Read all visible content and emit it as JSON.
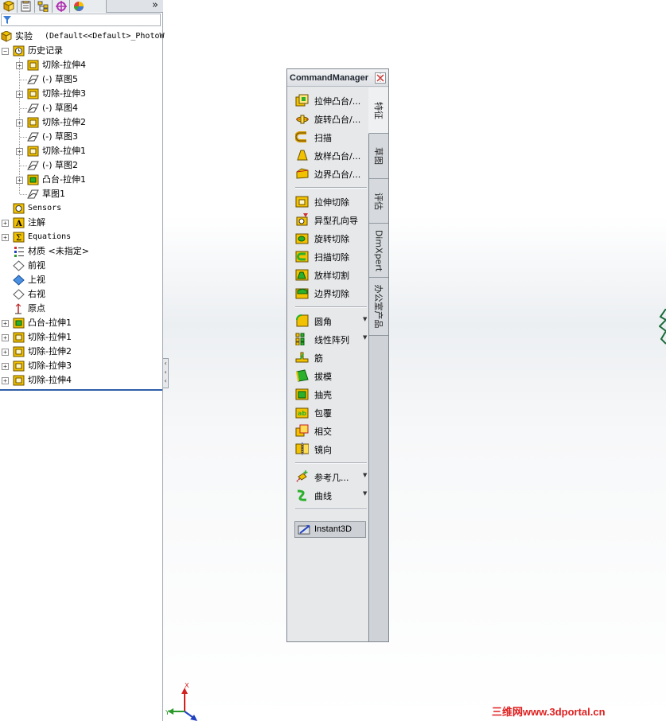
{
  "feature_manager": {
    "tabs": [
      "feature-tree-icon",
      "property-icon",
      "configuration-icon",
      "dimxpert-icon",
      "display-icon"
    ],
    "more": "»",
    "part_label": "实验",
    "part_config": "(Default<<Default>_PhotoW",
    "history": "历史记录",
    "history_items": [
      {
        "label": "切除-拉伸4",
        "type": "cut"
      },
      {
        "label": "(-) 草图5",
        "type": "sketch"
      },
      {
        "label": "切除-拉伸3",
        "type": "cut"
      },
      {
        "label": "(-) 草图4",
        "type": "sketch"
      },
      {
        "label": "切除-拉伸2",
        "type": "cut"
      },
      {
        "label": "(-) 草图3",
        "type": "sketch"
      },
      {
        "label": "切除-拉伸1",
        "type": "cut"
      },
      {
        "label": "(-) 草图2",
        "type": "sketch"
      },
      {
        "label": "凸台-拉伸1",
        "type": "boss"
      },
      {
        "label": "草图1",
        "type": "sketch"
      }
    ],
    "sensors": "Sensors",
    "annotations": "注解",
    "equations": "Equations",
    "material": "材质 <未指定>",
    "front_plane": "前视",
    "top_plane": "上视",
    "right_plane": "右视",
    "origin": "原点",
    "features": [
      "凸台-拉伸1",
      "切除-拉伸1",
      "切除-拉伸2",
      "切除-拉伸3",
      "切除-拉伸4"
    ]
  },
  "command_manager": {
    "title": "CommandManager",
    "groups": [
      [
        {
          "label": "拉伸凸台/...",
          "icon": "extrude-boss-icon"
        },
        {
          "label": "旋转凸台/...",
          "icon": "revolve-boss-icon"
        },
        {
          "label": "扫描",
          "icon": "sweep-icon"
        },
        {
          "label": "放样凸台/...",
          "icon": "loft-icon"
        },
        {
          "label": "边界凸台/...",
          "icon": "boundary-boss-icon"
        }
      ],
      [
        {
          "label": "拉伸切除",
          "icon": "extrude-cut-icon"
        },
        {
          "label": "异型孔向导",
          "icon": "hole-wizard-icon"
        },
        {
          "label": "旋转切除",
          "icon": "revolve-cut-icon"
        },
        {
          "label": "扫描切除",
          "icon": "sweep-cut-icon"
        },
        {
          "label": "放样切割",
          "icon": "loft-cut-icon"
        },
        {
          "label": "边界切除",
          "icon": "boundary-cut-icon"
        }
      ],
      [
        {
          "label": "圆角",
          "icon": "fillet-icon",
          "dropdown": true
        },
        {
          "label": "线性阵列",
          "icon": "linear-pattern-icon",
          "dropdown": true
        },
        {
          "label": "筋",
          "icon": "rib-icon"
        },
        {
          "label": "拔模",
          "icon": "draft-icon"
        },
        {
          "label": "抽壳",
          "icon": "shell-icon"
        },
        {
          "label": "包覆",
          "icon": "wrap-icon"
        },
        {
          "label": "相交",
          "icon": "intersect-icon"
        },
        {
          "label": "镜向",
          "icon": "mirror-icon"
        }
      ],
      [
        {
          "label": "参考几...",
          "icon": "reference-geometry-icon",
          "dropdown": true
        },
        {
          "label": "曲线",
          "icon": "curves-icon",
          "dropdown": true
        }
      ]
    ],
    "instant3d": "Instant3D",
    "tabs": [
      "特征",
      "草图",
      "评估",
      "DimXpert",
      "办公室产品"
    ],
    "dropdown_glyph": "▼"
  },
  "triad": {
    "x": "X",
    "y": "Y"
  },
  "watermark": "三维网www.3dportal.cn",
  "colors": {
    "tree_selection": "#2f5fa8",
    "watermark": "#e02020",
    "icon_yellow": "#f2c200",
    "icon_green": "#2bb02b"
  }
}
